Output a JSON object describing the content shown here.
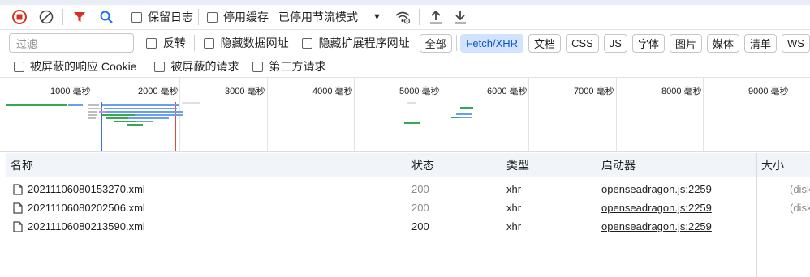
{
  "toolbar": {
    "record_icon": "record-stop-icon",
    "clear_icon": "clear-icon",
    "filter_icon": "filter-icon",
    "search_icon": "search-icon",
    "preserve_log": "保留日志",
    "disable_cache": "停用缓存",
    "throttle_value": "已停用节流模式",
    "wifi_icon": "network-conditions-icon",
    "import_icon": "upload-icon",
    "export_icon": "download-icon"
  },
  "filter": {
    "placeholder": "过滤",
    "invert": "反转",
    "hide_data_urls": "隐藏数据网址",
    "hide_extension_urls": "隐藏扩展程序网址",
    "types": [
      "全部",
      "Fetch/XHR",
      "文档",
      "CSS",
      "JS",
      "字体",
      "图片",
      "媒体",
      "清单",
      "WS"
    ],
    "active_type": "Fetch/XHR"
  },
  "options": {
    "blocked_cookies": "被屏蔽的响应 Cookie",
    "blocked_requests": "被屏蔽的请求",
    "third_party": "第三方请求"
  },
  "overview": {
    "ticks": [
      "1000 毫秒",
      "2000 毫秒",
      "3000 毫秒",
      "4000 毫秒",
      "5000 毫秒",
      "6000 毫秒",
      "7000 毫秒",
      "8000 毫秒",
      "9000 毫秒"
    ],
    "colors": {
      "blue": "#6d9eeb",
      "green": "#34a853",
      "gray": "#bdbdbd",
      "red_line": "#e8453c",
      "blue_line": "#3b6fd6"
    }
  },
  "table": {
    "columns": [
      "名称",
      "状态",
      "类型",
      "启动器",
      "大小"
    ],
    "rows": [
      {
        "name": "20211106080153270.xml",
        "status": "200",
        "type": "xhr",
        "initiator": "openseadragon.js:2259",
        "size": "(disk"
      },
      {
        "name": "20211106080202506.xml",
        "status": "200",
        "type": "xhr",
        "initiator": "openseadragon.js:2259",
        "size": "(disk"
      },
      {
        "name": "20211106080213590.xml",
        "status": "200",
        "type": "xhr",
        "initiator": "openseadragon.js:2259",
        "size": ""
      }
    ]
  }
}
